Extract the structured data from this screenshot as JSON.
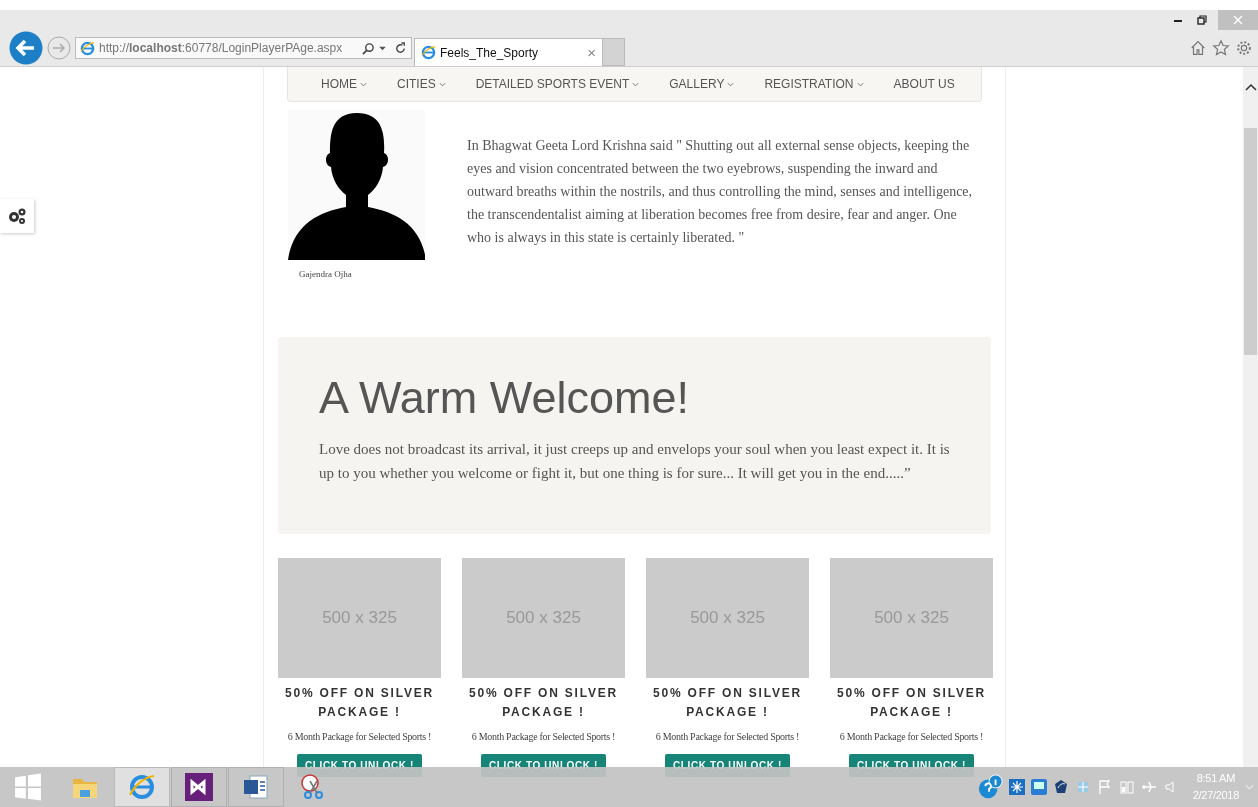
{
  "browser": {
    "url": "http://**localhost**:60778/LoginPlayerPAge.aspx",
    "tab_title": "Feels_The_Sporty",
    "tab_close": "×"
  },
  "nav": [
    {
      "label": "HOME",
      "has_dropdown": true
    },
    {
      "label": "CITIES",
      "has_dropdown": true
    },
    {
      "label": "DETAILED SPORTS EVENT",
      "has_dropdown": true
    },
    {
      "label": "GALLERY",
      "has_dropdown": true
    },
    {
      "label": "REGISTRATION",
      "has_dropdown": true
    },
    {
      "label": "ABOUT US",
      "has_dropdown": false
    }
  ],
  "profile": {
    "name": "Gajendra Ojha",
    "quote": "In Bhagwat Geeta Lord Krishna said \" Shutting out all external sense objects, keeping the eyes and vision concentrated between the two eyebrows, suspending the inward and outward breaths within the nostrils, and thus controlling the mind, senses and intelligence, the transcendentalist aiming at liberation becomes free from desire, fear and anger. One who is always in this state is certainly liberated. \""
  },
  "welcome": {
    "title": "A Warm Welcome!",
    "text": "Love does not broadcast its arrival, it just creeps up and envelops your soul when you least expect it. It is up to you whether you welcome or fight it, but one thing is for sure... It will get you in the end.....”"
  },
  "cards": [
    {
      "image_label": "500 x 325",
      "title": "50% OFF ON SILVER PACKAGE !",
      "subtitle": "6 Month Package for Selected Sports !",
      "button": "CLICK TO UNLOCK !"
    },
    {
      "image_label": "500 x 325",
      "title": "50% OFF ON SILVER PACKAGE !",
      "subtitle": "6 Month Package for Selected Sports !",
      "button": "CLICK TO UNLOCK !"
    },
    {
      "image_label": "500 x 325",
      "title": "50% OFF ON SILVER PACKAGE !",
      "subtitle": "6 Month Package for Selected Sports !",
      "button": "CLICK TO UNLOCK !"
    },
    {
      "image_label": "500 x 325",
      "title": "50% OFF ON SILVER PACKAGE !",
      "subtitle": "6 Month Package for Selected Sports !",
      "button": "CLICK TO UNLOCK !"
    }
  ],
  "taskbar": {
    "apps": [
      {
        "kind": "start",
        "selected": false
      },
      {
        "kind": "folder",
        "selected": false
      },
      {
        "kind": "browser",
        "selected": true
      },
      {
        "kind": "studio",
        "selected": false
      },
      {
        "kind": "word",
        "selected": false
      },
      {
        "kind": "snip",
        "selected": false
      }
    ],
    "time": "8:51 AM",
    "date": "2/27/2018"
  }
}
